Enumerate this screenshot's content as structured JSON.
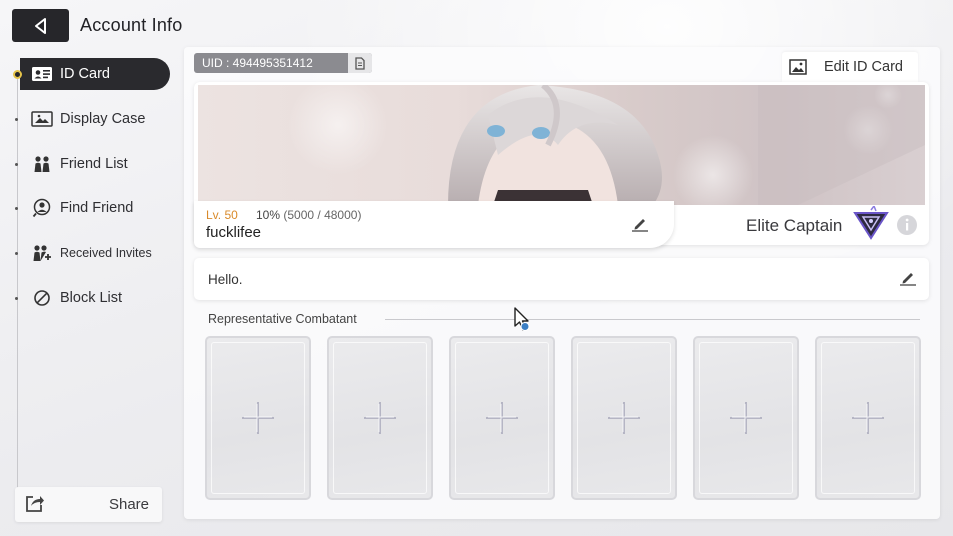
{
  "header": {
    "title": "Account Info",
    "back_icon": "back-arrow-icon"
  },
  "sidebar": {
    "items": [
      {
        "label": "ID Card",
        "icon": "id-card-icon",
        "active": true
      },
      {
        "label": "Display Case",
        "icon": "display-case-icon",
        "active": false
      },
      {
        "label": "Friend List",
        "icon": "friends-icon",
        "active": false
      },
      {
        "label": "Find Friend",
        "icon": "find-friend-icon",
        "active": false
      },
      {
        "label": "Received Invites",
        "icon": "invites-icon",
        "active": false
      },
      {
        "label": "Block List",
        "icon": "block-icon",
        "active": false
      }
    ],
    "share_label": "Share"
  },
  "profile": {
    "uid": "UID : 494495351412",
    "edit_card_label": "Edit ID Card",
    "level": "Lv. 50",
    "exp_percent": "10%",
    "exp_detail": "(5000 / 48000)",
    "exp_fraction": 0.104,
    "username": "fucklifee",
    "rank_title": "Elite Captain",
    "greeting": "Hello."
  },
  "representative": {
    "label": "Representative Combatant",
    "slots": [
      "empty",
      "empty",
      "empty",
      "empty",
      "empty",
      "empty"
    ]
  },
  "colors": {
    "accent_dark": "#26262a",
    "level_orange": "#d98a2a",
    "rank_purple": "#6a55c8"
  }
}
